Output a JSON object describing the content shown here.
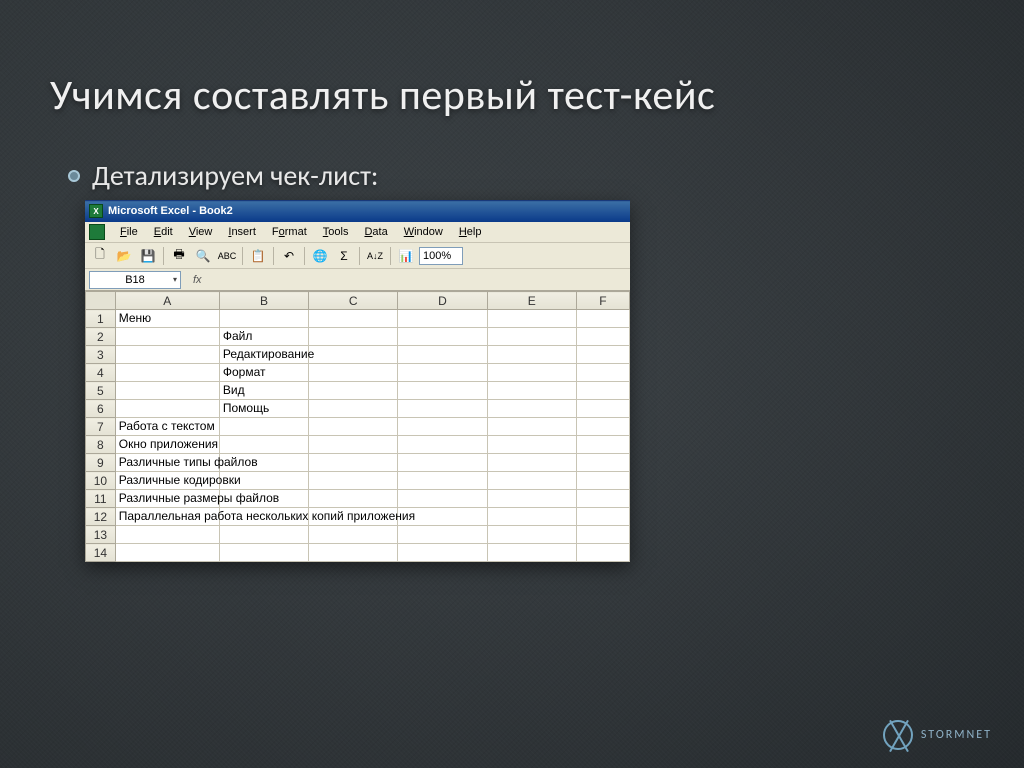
{
  "slide": {
    "title": "Учимся составлять первый тест-кейс",
    "bullet": "Детализируем чек-лист:"
  },
  "excel": {
    "titlebar": "Microsoft Excel - Book2",
    "menu": {
      "file": "File",
      "edit": "Edit",
      "view": "View",
      "insert": "Insert",
      "format": "Format",
      "tools": "Tools",
      "data": "Data",
      "window": "Window",
      "help": "Help"
    },
    "toolbar": {
      "zoom": "100%"
    },
    "namebox": "B18",
    "fx": "fx",
    "columns": [
      "A",
      "B",
      "C",
      "D",
      "E",
      "F"
    ],
    "rows": [
      {
        "n": "1",
        "A": "Меню",
        "B": ""
      },
      {
        "n": "2",
        "A": "",
        "B": "Файл"
      },
      {
        "n": "3",
        "A": "",
        "B": "Редактирование"
      },
      {
        "n": "4",
        "A": "",
        "B": "Формат"
      },
      {
        "n": "5",
        "A": "",
        "B": "Вид"
      },
      {
        "n": "6",
        "A": "",
        "B": "Помощь"
      },
      {
        "n": "7",
        "A": "Работа с текстом",
        "B": ""
      },
      {
        "n": "8",
        "A": "Окно приложения",
        "B": ""
      },
      {
        "n": "9",
        "A": "Различные типы файлов",
        "B": ""
      },
      {
        "n": "10",
        "A": "Различные кодировки",
        "B": ""
      },
      {
        "n": "11",
        "A": "Различные размеры файлов",
        "B": ""
      },
      {
        "n": "12",
        "A": "Параллельная работа нескольких копий приложения",
        "B": ""
      },
      {
        "n": "13",
        "A": "",
        "B": ""
      },
      {
        "n": "14",
        "A": "",
        "B": ""
      }
    ]
  },
  "branding": {
    "name": "STORMNET"
  }
}
